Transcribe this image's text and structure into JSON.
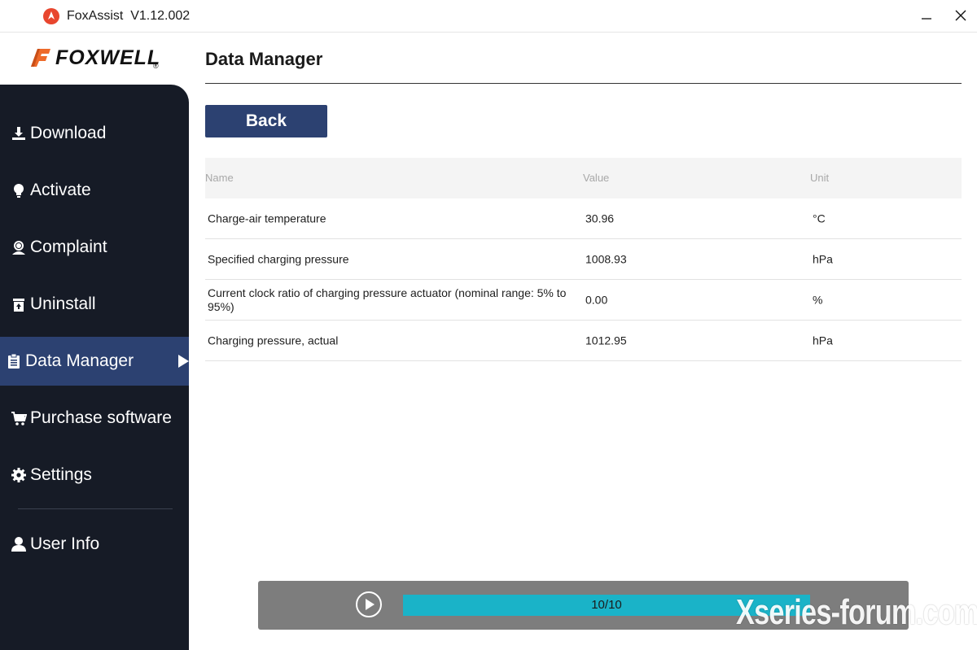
{
  "window": {
    "title": "FoxAssist",
    "version": "V1.12.002"
  },
  "brand": {
    "logo_text": "FOXWELL",
    "logo_mark": "®"
  },
  "sidebar": {
    "items": [
      {
        "label": "Download",
        "icon": "download-icon"
      },
      {
        "label": "Activate",
        "icon": "lightbulb-icon"
      },
      {
        "label": "Complaint",
        "icon": "support-agent-icon"
      },
      {
        "label": "Uninstall",
        "icon": "trash-icon"
      },
      {
        "label": "Data Manager",
        "icon": "clipboard-icon",
        "active": true
      },
      {
        "label": "Purchase software",
        "icon": "cart-icon"
      },
      {
        "label": "Settings",
        "icon": "gear-icon"
      },
      {
        "label": "User Info",
        "icon": "user-icon"
      }
    ]
  },
  "main": {
    "title": "Data Manager",
    "back_label": "Back",
    "table": {
      "headers": {
        "name": "Name",
        "value": "Value",
        "unit": "Unit"
      },
      "rows": [
        {
          "name": "Charge-air temperature",
          "value": "30.96",
          "unit": "°C"
        },
        {
          "name": "Specified charging pressure",
          "value": "1008.93",
          "unit": "hPa"
        },
        {
          "name": "Current clock ratio of charging pressure actuator (nominal range: 5% to 95%)",
          "value": "0.00",
          "unit": "%"
        },
        {
          "name": "Charging pressure, actual",
          "value": "1012.95",
          "unit": "hPa"
        }
      ]
    }
  },
  "player": {
    "progress_text": "10/10",
    "progress_fraction": 1.0
  },
  "watermark": "Xseries-forum.com",
  "colors": {
    "accent": "#2c4171",
    "sidebar_bg": "#161b26",
    "progress": "#1ab3c8",
    "brand_orange": "#ee6a2a"
  }
}
